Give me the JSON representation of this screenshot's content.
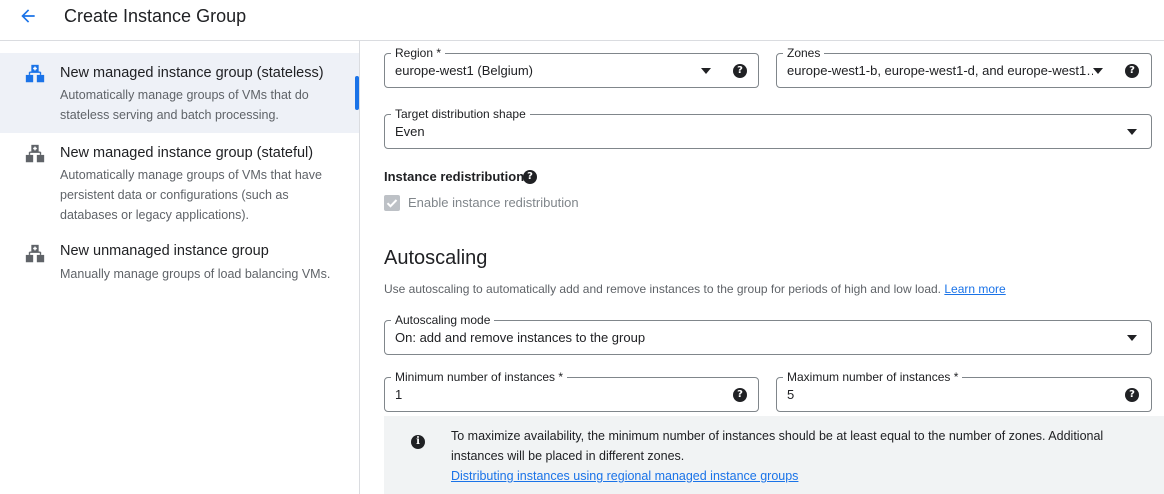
{
  "header": {
    "title": "Create Instance Group"
  },
  "sidebar": {
    "options": [
      {
        "title": "New managed instance group (stateless)",
        "description": "Automatically manage groups of VMs that do stateless serving and batch processing.",
        "selected": true
      },
      {
        "title": "New managed instance group (stateful)",
        "description": "Automatically manage groups of VMs that have persistent data or configurations (such as databases or legacy applications).",
        "selected": false
      },
      {
        "title": "New unmanaged instance group",
        "description": "Manually manage groups of load balancing VMs.",
        "selected": false
      }
    ]
  },
  "location": {
    "region_label": "Region *",
    "region_value": "europe-west1 (Belgium)",
    "zones_label": "Zones",
    "zones_value": "europe-west1-b, europe-west1-d, and europe-west1…",
    "distribution_label": "Target distribution shape",
    "distribution_value": "Even",
    "redistribution_label": "Instance redistribution",
    "redistribution_checkbox_label": "Enable instance redistribution",
    "redistribution_checked": true
  },
  "autoscaling": {
    "heading": "Autoscaling",
    "description": "Use autoscaling to automatically add and remove instances to the group for periods of high and low load.",
    "learn_more": "Learn more",
    "mode_label": "Autoscaling mode",
    "mode_value": "On: add and remove instances to the group",
    "min_label": "Minimum number of instances *",
    "min_value": "1",
    "max_label": "Maximum number of instances *",
    "max_value": "5",
    "info_text": "To maximize availability, the minimum number of instances should be at least equal to the number of zones. Additional instances will be placed in different zones.",
    "info_link": "Distributing instances using regional managed instance groups"
  },
  "colors": {
    "accent": "#1a73e8",
    "selected_bg": "#eef1f7",
    "info_bg": "#f1f3f4"
  }
}
